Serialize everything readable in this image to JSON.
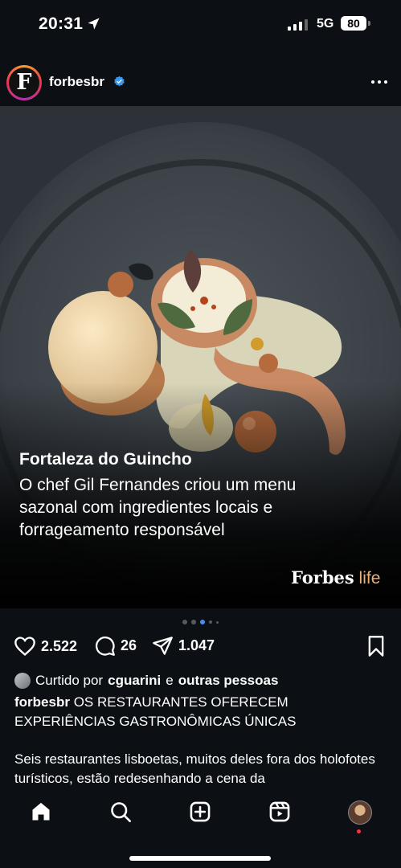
{
  "status_bar": {
    "time": "20:31",
    "network": "5G",
    "battery": "80"
  },
  "post": {
    "username": "forbesbr",
    "avatar_letter": "F",
    "caption_title": "Fortaleza do Guincho",
    "caption_body": "O chef Gil Fernandes criou um menu sazonal com ingredientes locais e forrageamento responsável",
    "brand_word": "Forbes",
    "brand_suffix": "life"
  },
  "carousel": {
    "count": 5,
    "active": 3
  },
  "actions": {
    "likes": "2.522",
    "comments": "26",
    "shares": "1.047"
  },
  "liked_by": {
    "prefix": "Curtido por",
    "user": "cguarini",
    "conj": "e",
    "others": "outras pessoas"
  },
  "caption": {
    "username": "forbesbr",
    "headline": "OS RESTAURANTES OFERECEM EXPERIÊNCIAS GASTRONÔMICAS ÚNICAS",
    "body": "Seis restaurantes lisboetas, muitos deles fora dos holofotes turísticos, estão redesenhando a cena da"
  },
  "icons": {
    "location": "location-arrow-icon",
    "verified": "verified-badge-icon",
    "like": "heart-icon",
    "comment": "comment-icon",
    "share": "send-icon",
    "save": "bookmark-icon",
    "home": "home-icon",
    "search": "search-icon",
    "create": "plus-square-icon",
    "reels": "reels-icon",
    "profile": "profile-avatar"
  },
  "colors": {
    "background": "#0c0f14",
    "verified": "#3897f0",
    "brand_suffix": "#e8b07a",
    "active_dot": "#4b8cf0",
    "notification": "#ff3040"
  }
}
